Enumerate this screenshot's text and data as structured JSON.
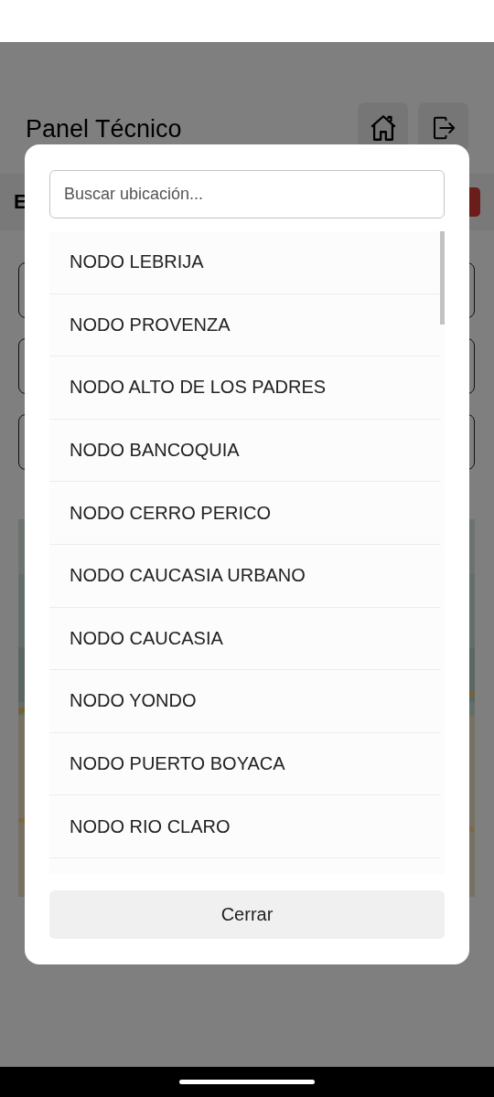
{
  "header": {
    "title": "Panel Técnico"
  },
  "subbar": {
    "label": "E"
  },
  "picker": {
    "search": {
      "placeholder": "Buscar ubicación..."
    },
    "items": [
      {
        "label": "NODO LEBRIJA"
      },
      {
        "label": "NODO PROVENZA"
      },
      {
        "label": "NODO ALTO DE LOS PADRES"
      },
      {
        "label": "NODO BANCOQUIA"
      },
      {
        "label": "NODO CERRO PERICO"
      },
      {
        "label": "NODO CAUCASIA URBANO"
      },
      {
        "label": "NODO CAUCASIA"
      },
      {
        "label": "NODO YONDO"
      },
      {
        "label": "NODO PUERTO BOYACA"
      },
      {
        "label": "NODO RIO CLARO"
      }
    ],
    "close_button": "Cerrar"
  }
}
